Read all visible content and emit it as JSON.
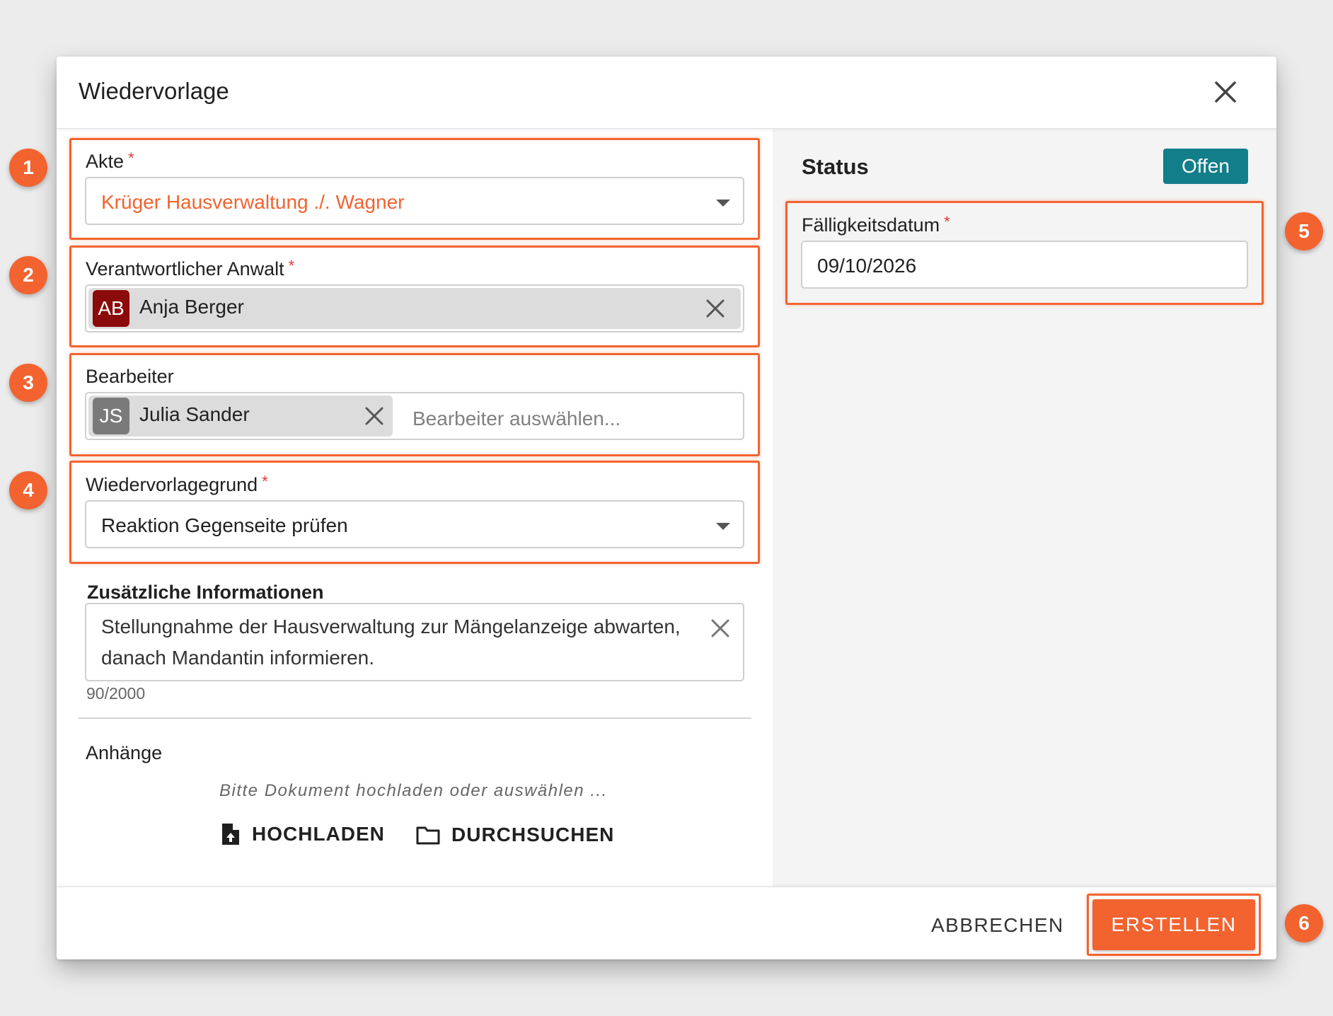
{
  "dialog": {
    "title": "Wiedervorlage"
  },
  "fields": {
    "akte": {
      "label": "Akte",
      "required_mark": "*",
      "value": "Krüger Hausverwaltung ./. Wagner"
    },
    "anwalt": {
      "label": "Verantwortlicher Anwalt",
      "required_mark": "*",
      "chip_initials": "AB",
      "chip_name": "Anja Berger"
    },
    "bearbeiter": {
      "label": "Bearbeiter",
      "chip_initials": "JS",
      "chip_name": "Julia Sander",
      "placeholder": "Bearbeiter auswählen..."
    },
    "grund": {
      "label": "Wiedervorlagegrund",
      "required_mark": "*",
      "value": "Reaktion Gegenseite prüfen"
    },
    "info": {
      "label": "Zusätzliche Informationen",
      "line1": "Stellungnahme der Hausverwaltung zur Mängelanzeige abwarten,",
      "line2": "danach Mandantin informieren.",
      "counter": "90/2000"
    },
    "attachments": {
      "label": "Anhänge",
      "hint": "Bitte Dokument hochladen oder auswählen ...",
      "upload_label": "HOCHLADEN",
      "browse_label": "DURCHSUCHEN"
    }
  },
  "status_panel": {
    "title": "Status",
    "status_value": "Offen",
    "due_label": "Fälligkeitsdatum",
    "required_mark": "*",
    "due_value": "09/10/2026"
  },
  "footer": {
    "cancel_label": "ABBRECHEN",
    "create_label": "ERSTELLEN"
  },
  "annotations": [
    "1",
    "2",
    "3",
    "4",
    "5",
    "6"
  ],
  "colors": {
    "accent": "#f26330",
    "status_chip": "#127e8a",
    "avatar_ab": "#8b0b0b",
    "avatar_js": "#7a7a7a",
    "required": "#e53935"
  }
}
